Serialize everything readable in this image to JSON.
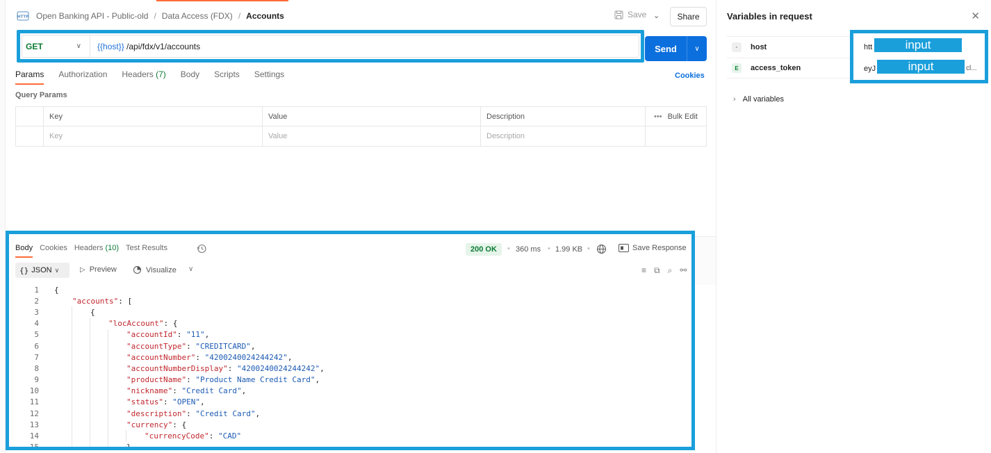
{
  "breadcrumb": {
    "collection": "Open Banking API - Public-old",
    "folder": "Data Access (FDX)",
    "request": "Accounts",
    "separator": "/"
  },
  "toolbar": {
    "save_label": "Save",
    "share_label": "Share"
  },
  "request": {
    "method": "GET",
    "url_variable": "{{host}}",
    "url_path": " /api/fdx/v1/accounts",
    "send_label": "Send"
  },
  "request_tabs": {
    "params": "Params",
    "authorization": "Authorization",
    "headers": "Headers",
    "headers_count": "(7)",
    "body": "Body",
    "scripts": "Scripts",
    "settings": "Settings",
    "cookies": "Cookies"
  },
  "query_params": {
    "title": "Query Params",
    "columns": [
      "Key",
      "Value",
      "Description"
    ],
    "bulk_edit": "Bulk Edit",
    "placeholders": [
      "Key",
      "Value",
      "Description"
    ]
  },
  "variables_panel": {
    "title": "Variables in request",
    "variables": [
      {
        "badge": "-",
        "name": "host",
        "value_prefix": "htt",
        "redacted_label": "input"
      },
      {
        "badge": "E",
        "name": "access_token",
        "value_prefix": "eyJ",
        "value_suffix": "cl...",
        "redacted_label": "input"
      }
    ],
    "all_variables": "All variables"
  },
  "response": {
    "tabs": {
      "body": "Body",
      "cookies": "Cookies",
      "headers": "Headers",
      "headers_count": "(10)",
      "test_results": "Test Results"
    },
    "status": "200 OK",
    "time": "360 ms",
    "size": "1.99 KB",
    "save_response": "Save Response",
    "format": "JSON",
    "format_brace": "{}",
    "preview": "Preview",
    "visualize": "Visualize"
  },
  "code_lines": [
    {
      "n": "1",
      "indent": 0,
      "text": "{"
    },
    {
      "n": "2",
      "indent": 1,
      "key": "\"accounts\"",
      "rest": ": ["
    },
    {
      "n": "3",
      "indent": 2,
      "text": "{"
    },
    {
      "n": "4",
      "indent": 3,
      "key": "\"locAccount\"",
      "rest": ": {"
    },
    {
      "n": "5",
      "indent": 4,
      "key": "\"accountId\"",
      "sep": ": ",
      "val": "\"11\"",
      "end": ","
    },
    {
      "n": "6",
      "indent": 4,
      "key": "\"accountType\"",
      "sep": ": ",
      "val": "\"CREDITCARD\"",
      "end": ","
    },
    {
      "n": "7",
      "indent": 4,
      "key": "\"accountNumber\"",
      "sep": ": ",
      "val": "\"4200240024244242\"",
      "end": ","
    },
    {
      "n": "8",
      "indent": 4,
      "key": "\"accountNumberDisplay\"",
      "sep": ": ",
      "val": "\"4200240024244242\"",
      "end": ","
    },
    {
      "n": "9",
      "indent": 4,
      "key": "\"productName\"",
      "sep": ": ",
      "val": "\"Product Name Credit Card\"",
      "end": ","
    },
    {
      "n": "10",
      "indent": 4,
      "key": "\"nickname\"",
      "sep": ": ",
      "val": "\"Credit Card\"",
      "end": ","
    },
    {
      "n": "11",
      "indent": 4,
      "key": "\"status\"",
      "sep": ": ",
      "val": "\"OPEN\"",
      "end": ","
    },
    {
      "n": "12",
      "indent": 4,
      "key": "\"description\"",
      "sep": ": ",
      "val": "\"Credit Card\"",
      "end": ","
    },
    {
      "n": "13",
      "indent": 4,
      "key": "\"currency\"",
      "rest": ": {"
    },
    {
      "n": "14",
      "indent": 5,
      "key": "\"currencyCode\"",
      "sep": ": ",
      "val": "\"CAD\"",
      "end": ""
    },
    {
      "n": "15",
      "indent": 4,
      "text": "}"
    }
  ],
  "colors": {
    "accent_orange": "#ff6c37",
    "send_blue": "#0b6fde",
    "highlight_box": "#1a9fdb",
    "status_green": "#0c7a34",
    "json_key": "#c0262d",
    "json_string": "#1d5bb3"
  }
}
